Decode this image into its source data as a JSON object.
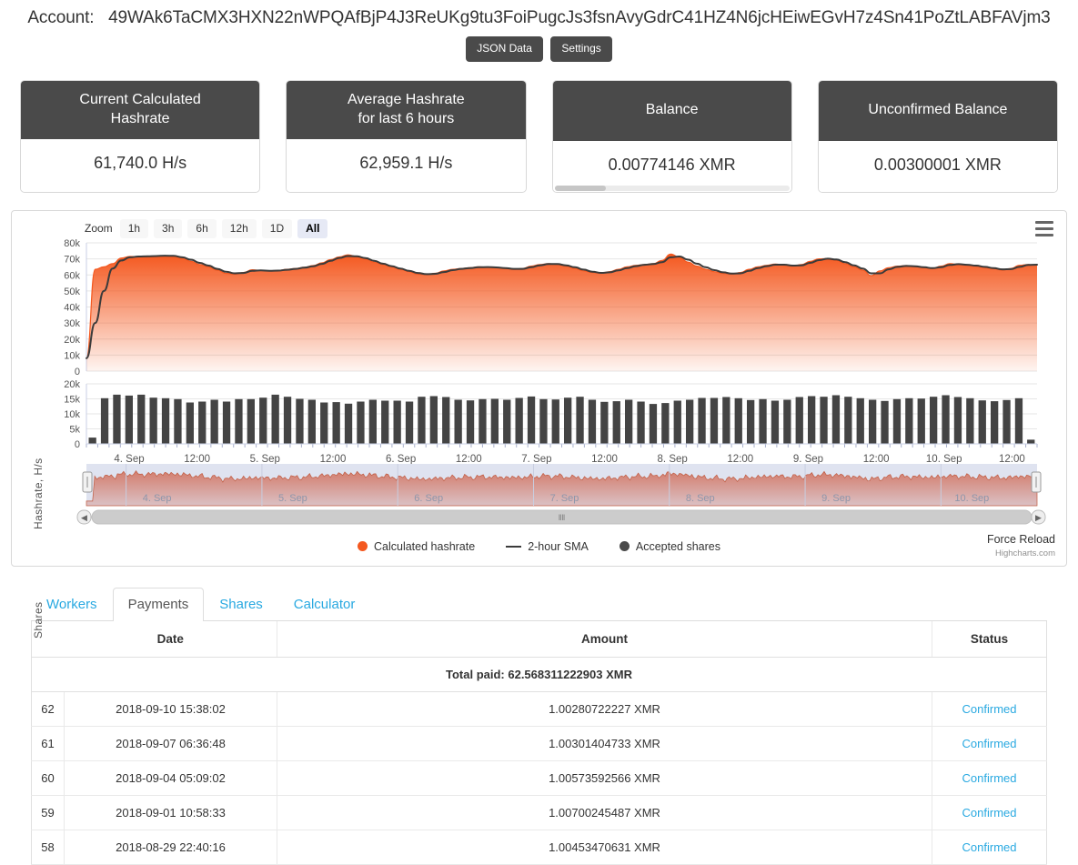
{
  "header": {
    "account_label": "Account:",
    "account_address": "49WAk6TaCMX3HXN22nWPQAfBjP4J3ReUKg9tu3FoiPugcJs3fsnAvyGdrC41HZ4N6jcHEiwEGvH7z4Sn41PoZtLABFAVjm3",
    "buttons": [
      {
        "label": "JSON Data"
      },
      {
        "label": "Settings"
      }
    ]
  },
  "cards": [
    {
      "title": "Current Calculated\nHashrate",
      "title_line1": "Current Calculated",
      "title_line2": "Hashrate",
      "value": "61,740.0 H/s",
      "has_scrollbar": false
    },
    {
      "title_line1": "Average Hashrate",
      "title_line2": "for last 6 hours",
      "value": "62,959.1 H/s",
      "has_scrollbar": false
    },
    {
      "title_line1": "Balance",
      "title_line2": "",
      "value": "0.00774146 XMR",
      "has_scrollbar": true
    },
    {
      "title_line1": "Unconfirmed Balance",
      "title_line2": "",
      "value": "0.00300001 XMR",
      "has_scrollbar": false
    }
  ],
  "chart": {
    "range_selector": {
      "label": "Zoom",
      "options": [
        "1h",
        "3h",
        "6h",
        "12h",
        "1D",
        "All"
      ],
      "selected": "All"
    },
    "menu_icon": "hamburger-icon",
    "legend": [
      {
        "name": "Calculated hashrate",
        "marker": "dot",
        "color": "#f4581f"
      },
      {
        "name": "2-hour SMA",
        "marker": "line",
        "color": "#3b3b3b"
      },
      {
        "name": "Accepted shares",
        "marker": "dot",
        "color": "#4a4a4a"
      }
    ],
    "force_reload_label": "Force Reload",
    "credit": "Highcharts.com",
    "navigator_labels": [
      "4. Sep",
      "5. Sep",
      "6. Sep",
      "7. Sep",
      "8. Sep",
      "9. Sep",
      "10. Sep"
    ]
  },
  "chart_data": [
    {
      "type": "area",
      "title": "",
      "ylabel": "Hashrate, H/s",
      "xlabel": "",
      "ylim": [
        0,
        80000
      ],
      "yticks": [
        "0",
        "10k",
        "20k",
        "30k",
        "40k",
        "50k",
        "60k",
        "70k",
        "80k"
      ],
      "xticks": [
        "4. Sep",
        "12:00",
        "5. Sep",
        "12:00",
        "6. Sep",
        "12:00",
        "7. Sep",
        "12:00",
        "8. Sep",
        "12:00",
        "9. Sep",
        "12:00",
        "10. Sep",
        "12:00"
      ],
      "grid": true,
      "legend_position": "bottom",
      "series": [
        {
          "name": "Calculated hashrate",
          "color": "#f4581f",
          "values": [
            8000,
            63500,
            65000,
            67000,
            70500,
            71500,
            71300,
            71200,
            71500,
            72000,
            71800,
            70500,
            68500,
            66500,
            65000,
            63000,
            61000,
            60500,
            61500,
            63200,
            62800,
            62500,
            62800,
            63500,
            64000,
            64800,
            65800,
            67500,
            69500,
            71200,
            72500,
            71500,
            70000,
            68000,
            66500,
            65000,
            63500,
            62000,
            60500,
            60200,
            61000,
            62500,
            63500,
            64000,
            64500,
            65000,
            64800,
            64500,
            64000,
            63500,
            64000,
            65500,
            66500,
            67000,
            66500,
            65500,
            64000,
            62500,
            61500,
            61000,
            62000,
            63500,
            65000,
            66000,
            66500,
            67000,
            69000,
            73000,
            71000,
            68000,
            65500,
            63500,
            62000,
            61000,
            60500,
            61500,
            63500,
            65000,
            66000,
            66800,
            66000,
            65500,
            66500,
            68500,
            70000,
            70200,
            69000,
            67000,
            65000,
            63000,
            59500,
            62500,
            64500,
            65500,
            65800,
            65200,
            64500,
            64000,
            65500,
            67000,
            66500,
            66000,
            65500,
            64500,
            64000,
            63000,
            64000,
            66000,
            66500,
            66200
          ]
        },
        {
          "name": "2-hour SMA",
          "color": "#3b3b3b",
          "values": [
            8000,
            30000,
            50000,
            64000,
            69000,
            71000,
            71500,
            71600,
            71800,
            72000,
            71900,
            71000,
            69500,
            67500,
            65800,
            63800,
            62000,
            61000,
            61200,
            62500,
            62800,
            62600,
            62700,
            63200,
            63800,
            64500,
            65400,
            66900,
            68800,
            70600,
            71800,
            71600,
            70500,
            68800,
            67000,
            65500,
            64000,
            62600,
            61200,
            60500,
            60700,
            61800,
            63000,
            63800,
            64300,
            64800,
            64900,
            64700,
            64300,
            63800,
            63800,
            64800,
            66000,
            66800,
            66800,
            66000,
            64800,
            63300,
            62000,
            61300,
            61600,
            62800,
            64300,
            65500,
            66300,
            66800,
            68000,
            71000,
            71500,
            69500,
            67000,
            64800,
            63000,
            61600,
            60800,
            61000,
            62500,
            64300,
            65500,
            66400,
            66400,
            65800,
            66000,
            67500,
            69200,
            70100,
            69600,
            68000,
            66000,
            64000,
            61000,
            61000,
            63500,
            65000,
            65600,
            65400,
            64800,
            64200,
            64800,
            66200,
            66700,
            66300,
            65800,
            65000,
            64300,
            63500,
            63600,
            65000,
            66200,
            66400
          ]
        }
      ]
    },
    {
      "type": "bar",
      "title": "",
      "ylabel": "Shares",
      "xlabel": "",
      "ylim": [
        0,
        20000
      ],
      "yticks": [
        "0",
        "5k",
        "10k",
        "15k",
        "20k"
      ],
      "grid": true,
      "categories": [
        "4. Sep",
        "12:00",
        "5. Sep",
        "12:00",
        "6. Sep",
        "12:00",
        "7. Sep",
        "12:00",
        "8. Sep",
        "12:00",
        "9. Sep",
        "12:00",
        "10. Sep",
        "12:00"
      ],
      "series": [
        {
          "name": "Accepted shares",
          "color": "#4a4a4a",
          "values": [
            2100,
            15200,
            16400,
            16100,
            16400,
            15400,
            15200,
            14900,
            13800,
            14100,
            14700,
            14100,
            14900,
            14900,
            15400,
            16400,
            15700,
            15000,
            14700,
            13800,
            13900,
            13400,
            14100,
            14700,
            14400,
            14400,
            14100,
            15700,
            15900,
            15600,
            14700,
            14500,
            14900,
            15000,
            14700,
            15300,
            15800,
            14900,
            14800,
            15400,
            15700,
            14700,
            14000,
            14200,
            14700,
            14100,
            13300,
            13600,
            14400,
            14700,
            15300,
            15300,
            15600,
            15200,
            14600,
            14900,
            14400,
            14700,
            15600,
            15900,
            15700,
            16200,
            15700,
            15200,
            14700,
            14300,
            14900,
            15200,
            15100,
            15700,
            16200,
            15600,
            15200,
            14500,
            14200,
            14600,
            15200,
            1400
          ]
        }
      ]
    }
  ],
  "tabs": [
    {
      "label": "Workers",
      "active": false
    },
    {
      "label": "Payments",
      "active": true
    },
    {
      "label": "Shares",
      "active": false
    },
    {
      "label": "Calculator",
      "active": false
    }
  ],
  "payments": {
    "total_paid": "Total paid: 62.568311222903 XMR",
    "columns": [
      "",
      "Date",
      "Amount",
      "Status"
    ],
    "rows": [
      {
        "idx": "62",
        "date": "2018-09-10 15:38:02",
        "amount": "1.00280722227 XMR",
        "status": "Confirmed"
      },
      {
        "idx": "61",
        "date": "2018-09-07 06:36:48",
        "amount": "1.00301404733 XMR",
        "status": "Confirmed"
      },
      {
        "idx": "60",
        "date": "2018-09-04 05:09:02",
        "amount": "1.00573592566 XMR",
        "status": "Confirmed"
      },
      {
        "idx": "59",
        "date": "2018-09-01 10:58:33",
        "amount": "1.00700245487 XMR",
        "status": "Confirmed"
      },
      {
        "idx": "58",
        "date": "2018-08-29 22:40:16",
        "amount": "1.00453470631 XMR",
        "status": "Confirmed"
      }
    ]
  }
}
